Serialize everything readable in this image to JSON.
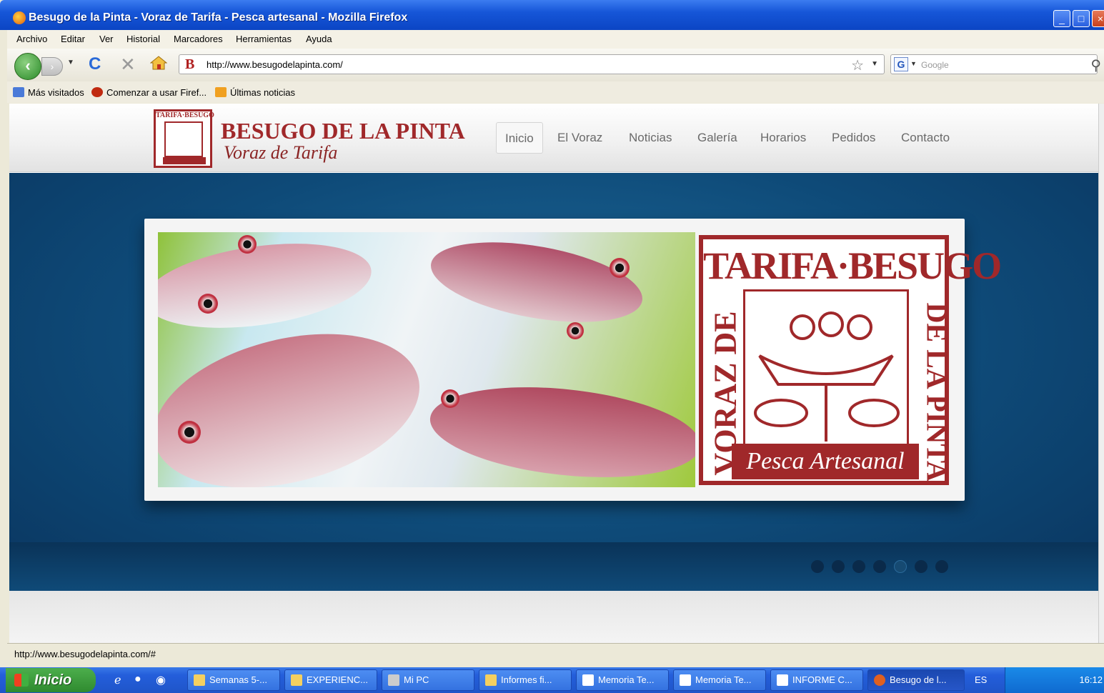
{
  "window": {
    "title": "Besugo de la Pinta - Voraz de Tarifa - Pesca artesanal - Mozilla Firefox"
  },
  "menu": [
    "Archivo",
    "Editar",
    "Ver",
    "Historial",
    "Marcadores",
    "Herramientas",
    "Ayuda"
  ],
  "toolbar": {
    "url": "http://www.besugodelapinta.com/",
    "search_placeholder": "Google",
    "favicon_letter": "B"
  },
  "bookmarks": [
    "Más visitados",
    "Comenzar a usar Firef...",
    "Últimas noticias"
  ],
  "site": {
    "logo_top": "TARIFA·BESUGO",
    "brand": "BESUGO DE LA PINTA",
    "tagline": "Voraz de Tarifa",
    "nav": [
      "Inicio",
      "El Voraz",
      "Noticias",
      "Galería",
      "Horarios",
      "Pedidos",
      "Contacto"
    ],
    "active_nav": "Inicio",
    "stamp_top": "TARIFA·BESUGO",
    "stamp_left": "VORAZ DE",
    "stamp_right": "DE LA PINTA",
    "stamp_bottom": "Pesca Artesanal",
    "slider_count": 7,
    "slider_active": 5
  },
  "status": "http://www.besugodelapinta.com/#",
  "taskbar": {
    "start": "Inicio",
    "tasks": [
      "Semanas 5-...",
      "EXPERIENC...",
      "Mi PC",
      "Informes fi...",
      "Memoria Te...",
      "Memoria Te...",
      "INFORME C...",
      "Besugo de l..."
    ],
    "lang": "ES",
    "clock": "16:12"
  },
  "colors": {
    "brand_red": "#a0282a",
    "hero_blue": "#0e4a78",
    "xp_blue": "#245edb"
  }
}
